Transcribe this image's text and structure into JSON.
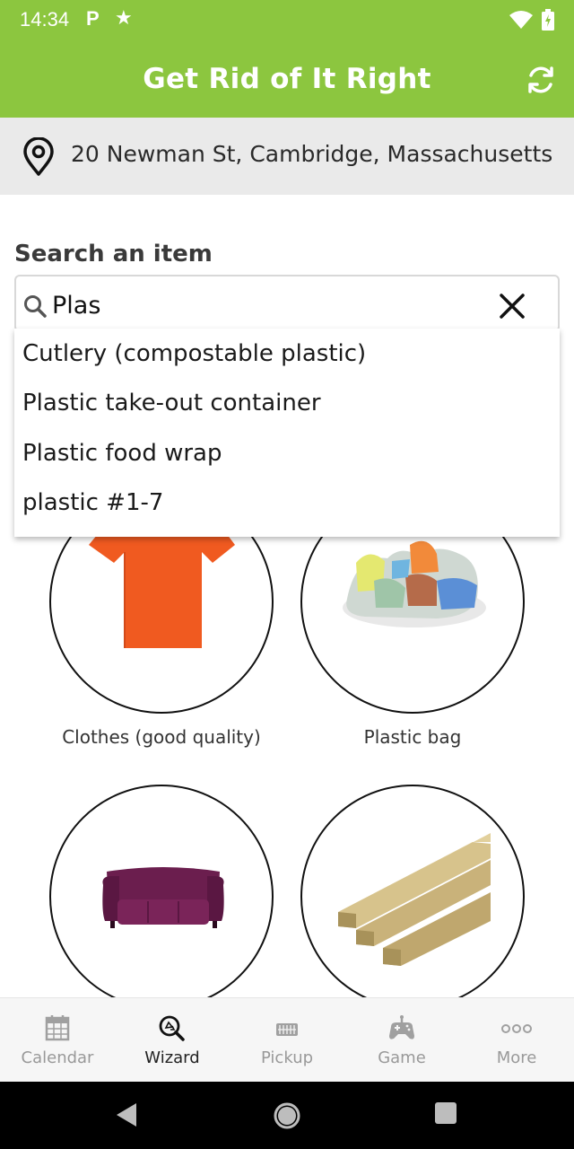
{
  "status_bar": {
    "time": "14:34",
    "notification_icons": [
      "parking-icon",
      "star-icon"
    ],
    "system_icons": [
      "wifi-icon",
      "battery-icon"
    ]
  },
  "app_bar": {
    "title": "Get Rid of It Right",
    "action_icon": "refresh-icon",
    "background_color": "#8cc63f"
  },
  "location": {
    "icon": "location-pin-icon",
    "address": "20 Newman St, Cambridge, Massachusetts"
  },
  "search": {
    "label": "Search an item",
    "value": "Plas",
    "suggestions": [
      "Cutlery (compostable plastic)",
      "Plastic take-out container",
      "Plastic food wrap",
      "plastic #1-7"
    ]
  },
  "items": [
    {
      "label": "Clothes (good quality)",
      "image": "orange-tshirt"
    },
    {
      "label": "Plastic bag",
      "image": "pile-of-plastic-bags"
    },
    {
      "label": "",
      "image": "purple-sofa"
    },
    {
      "label": "",
      "image": "lumber-planks"
    }
  ],
  "bottom_nav": {
    "active": "Wizard",
    "items": [
      {
        "label": "Calendar",
        "icon": "calendar-icon"
      },
      {
        "label": "Wizard",
        "icon": "recycle-search-icon"
      },
      {
        "label": "Pickup",
        "icon": "truck-icon"
      },
      {
        "label": "Game",
        "icon": "gamepad-icon"
      },
      {
        "label": "More",
        "icon": "more-dots-icon"
      }
    ]
  },
  "system_nav": [
    "back-icon",
    "home-icon",
    "recents-icon"
  ]
}
